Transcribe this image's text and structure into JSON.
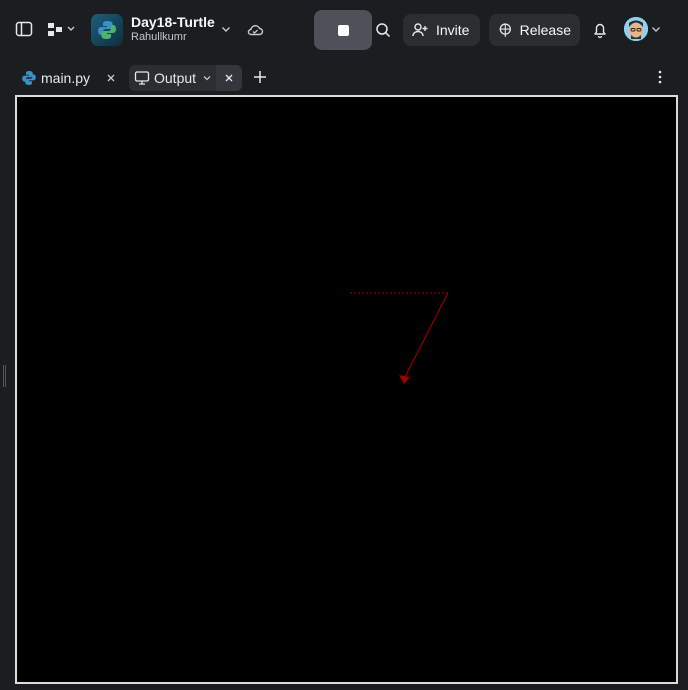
{
  "header": {
    "project_title": "Day18-Turtle",
    "owner": "Rahullkumr",
    "invite_label": "Invite",
    "release_label": "Release"
  },
  "tabs": [
    {
      "label": "main.py",
      "icon": "python-icon",
      "active": false
    },
    {
      "label": "Output",
      "icon": "monitor-icon",
      "active": true
    }
  ],
  "output": {
    "background": "#000000",
    "turtle_color": "#8b0000",
    "pen_style": "dashed"
  },
  "colors": {
    "app_bg": "#1c1d21",
    "button_bg": "#2b2d31",
    "stop_button_bg": "#4e5157",
    "canvas_border": "#dcdcdc"
  }
}
